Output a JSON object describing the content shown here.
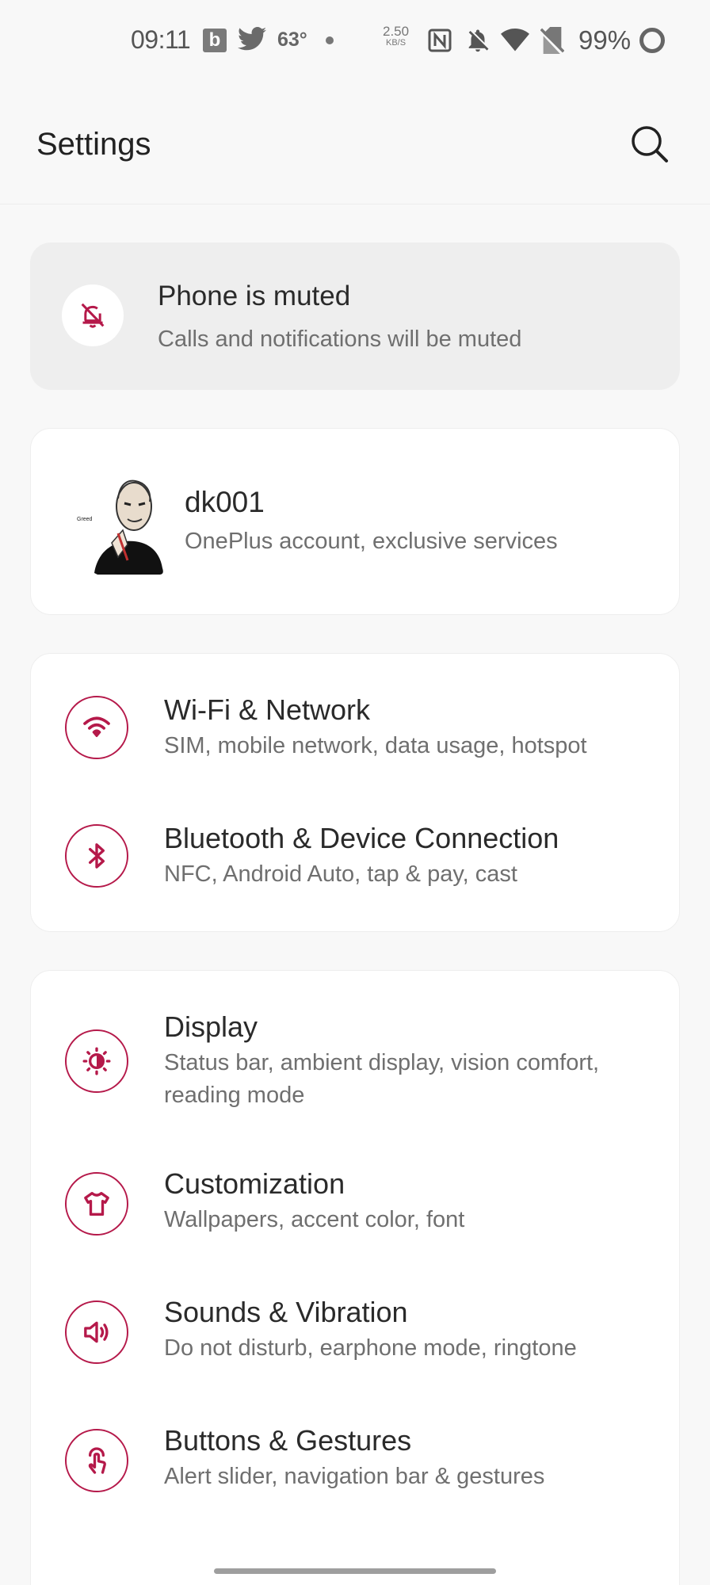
{
  "status_bar": {
    "time": "09:11",
    "b_badge": "b",
    "temperature": "63°",
    "net_speed_value": "2.50",
    "net_speed_unit": "KB/S",
    "battery": "99%",
    "icons": [
      "b-app-icon",
      "twitter-icon",
      "nfc-icon",
      "bell-off-icon",
      "wifi-icon",
      "no-sim-icon",
      "battery-ring-icon"
    ]
  },
  "header": {
    "title": "Settings",
    "search_icon": "search-icon"
  },
  "mute_banner": {
    "title": "Phone is muted",
    "subtitle": "Calls and notifications will be muted",
    "icon": "bell-off-icon"
  },
  "account": {
    "name": "dk001",
    "subtitle": "OnePlus account, exclusive services",
    "avatar_caption": "Greed"
  },
  "groups": [
    {
      "items": [
        {
          "title": "Wi-Fi & Network",
          "subtitle": "SIM, mobile network, data usage, hotspot",
          "icon": "wifi-icon"
        },
        {
          "title": "Bluetooth & Device Connection",
          "subtitle": "NFC, Android Auto, tap & pay, cast",
          "icon": "bluetooth-icon"
        }
      ]
    },
    {
      "items": [
        {
          "title": "Display",
          "subtitle": "Status bar, ambient display, vision comfort, reading mode",
          "icon": "brightness-icon"
        },
        {
          "title": "Customization",
          "subtitle": "Wallpapers, accent color, font",
          "icon": "tshirt-icon"
        },
        {
          "title": "Sounds & Vibration",
          "subtitle": "Do not disturb, earphone mode, ringtone",
          "icon": "speaker-icon"
        },
        {
          "title": "Buttons & Gestures",
          "subtitle": "Alert slider, navigation bar & gestures",
          "icon": "gesture-icon"
        }
      ]
    }
  ],
  "colors": {
    "accent": "#b5194a",
    "background": "#f8f8f8",
    "card": "#ffffff",
    "mute_card": "#eeeeee"
  }
}
